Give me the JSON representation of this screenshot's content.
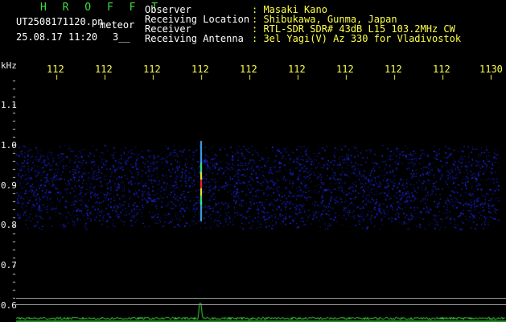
{
  "app_title": "H R O F F T",
  "filename": "UT2508171120.pn",
  "mode": "meteor",
  "timestamp": "25.08.17 11:20",
  "counter": "3__",
  "info": {
    "observer_label": "Observer",
    "observer_value": ": Masaki Kano",
    "location_label": "Receiving Location",
    "location_value": ": Shibukawa, Gunma, Japan",
    "receiver_label": "Receiver",
    "receiver_value": ": RTL-SDR SDR# 43dB L15 103.2MHz CW",
    "antenna_label": "Receiving Antenna",
    "antenna_value": ": 3el Yagi(V) Az 330 for Vladivostok"
  },
  "axis": {
    "y_unit": "kHz",
    "y_ticks": [
      "1.1",
      "1.0",
      "0.9",
      "0.8",
      "0.7",
      "0.6"
    ],
    "x_ticks": [
      "112",
      "112",
      "112",
      "112",
      "112",
      "112",
      "112",
      "112",
      "112",
      "1130"
    ]
  },
  "colors": {
    "noise": "#1a1aa0",
    "echo_core": "#ff3030",
    "spectrum": "#3fdc3f"
  }
}
